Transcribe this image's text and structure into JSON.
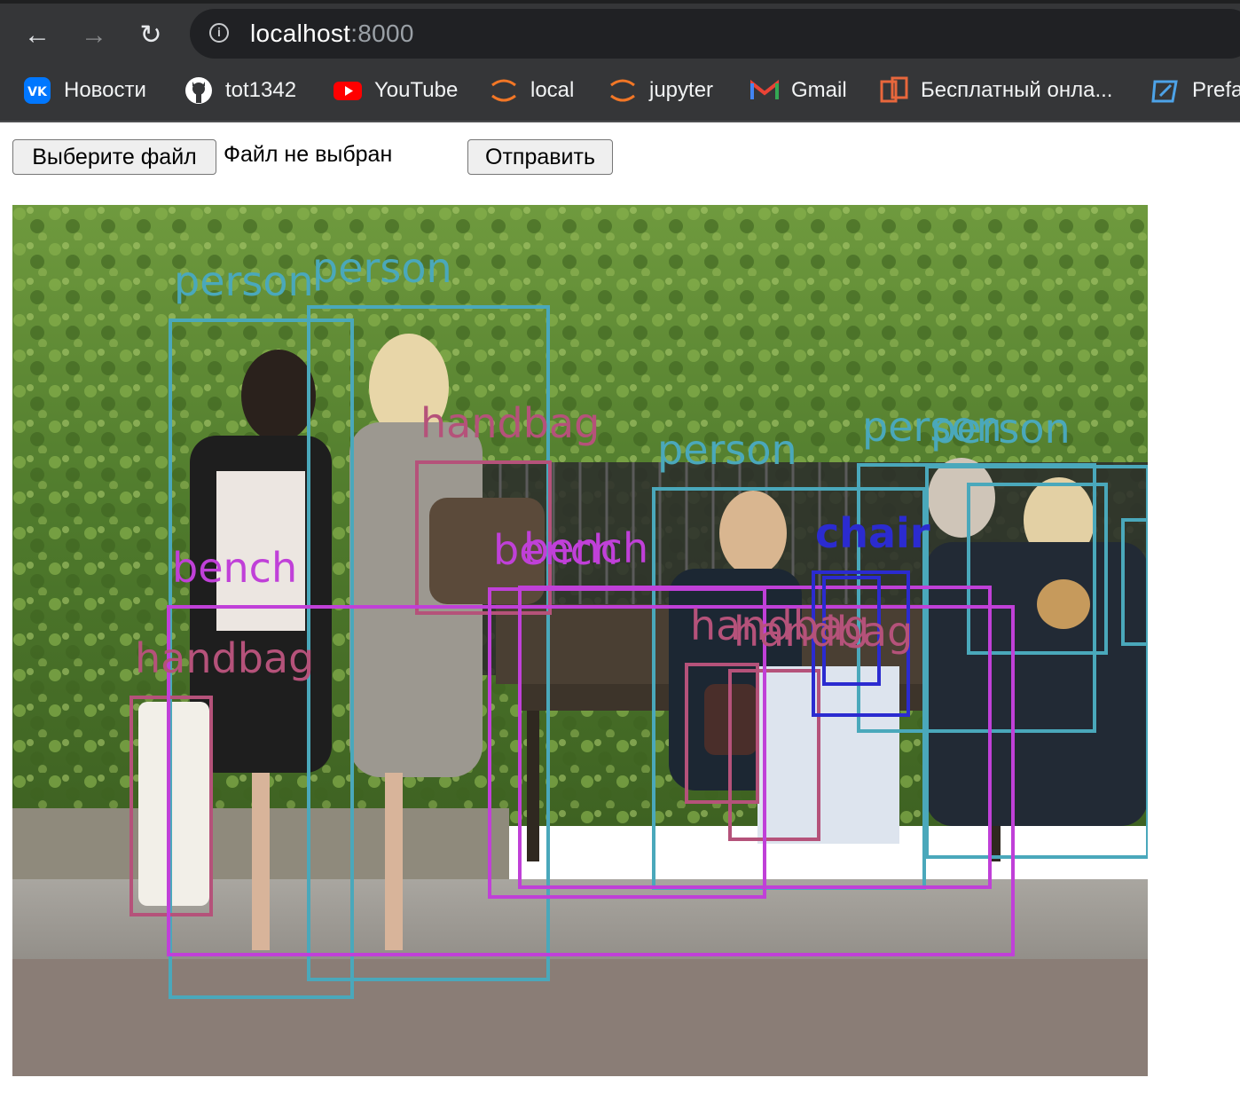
{
  "browser": {
    "url_host": "localhost",
    "url_port": ":8000",
    "nav": {
      "back": "←",
      "forward": "→",
      "reload": "↻"
    },
    "bookmarks": [
      {
        "label": "Новости",
        "icon": "vk-icon",
        "color": "#0077ff"
      },
      {
        "label": "tot1342",
        "icon": "github-icon",
        "color": "#ffffff"
      },
      {
        "label": "YouTube",
        "icon": "youtube-icon",
        "color": "#ff0000"
      },
      {
        "label": "local",
        "icon": "jupyter-icon",
        "color": "#f37726"
      },
      {
        "label": "jupyter",
        "icon": "jupyter-icon",
        "color": "#f37726"
      },
      {
        "label": "Gmail",
        "icon": "gmail-icon",
        "color": "#ea4335"
      },
      {
        "label": "Бесплатный онла...",
        "icon": "document-icon",
        "color": "#e8673c"
      },
      {
        "label": "Prefa",
        "icon": "prefab-icon",
        "color": "#4da3e8"
      }
    ]
  },
  "form": {
    "choose_file_label": "Выберите файл",
    "file_status": "Файл не выбран",
    "submit_label": "Отправить"
  },
  "detections": [
    {
      "label": "person",
      "color": "#4aa8bb"
    },
    {
      "label": "handbag",
      "color": "#b5527a"
    },
    {
      "label": "bench",
      "color": "#c040d8"
    },
    {
      "label": "chair",
      "color": "#2b2bd0"
    }
  ]
}
